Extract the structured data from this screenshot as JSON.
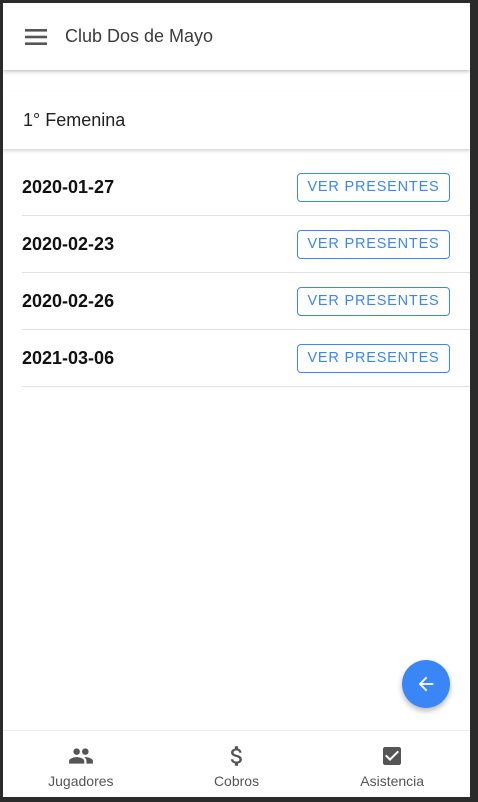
{
  "app_bar": {
    "title": "Club Dos de Mayo",
    "menu_icon": "menu-icon"
  },
  "section": {
    "title": "1° Femenina"
  },
  "attendance_dates": [
    {
      "date": "2020-01-27",
      "button_label": "VER PRESENTES"
    },
    {
      "date": "2020-02-23",
      "button_label": "VER PRESENTES"
    },
    {
      "date": "2020-02-26",
      "button_label": "VER PRESENTES"
    },
    {
      "date": "2021-03-06",
      "button_label": "VER PRESENTES"
    }
  ],
  "fab": {
    "icon": "arrow-back-icon"
  },
  "bottom_nav": {
    "items": [
      {
        "label": "Jugadores",
        "icon": "people-icon"
      },
      {
        "label": "Cobros",
        "icon": "dollar-icon"
      },
      {
        "label": "Asistencia",
        "icon": "checkbox-icon"
      }
    ]
  },
  "colors": {
    "accent": "#3b86f7",
    "text_primary": "#111111",
    "nav_icon": "#555555"
  }
}
